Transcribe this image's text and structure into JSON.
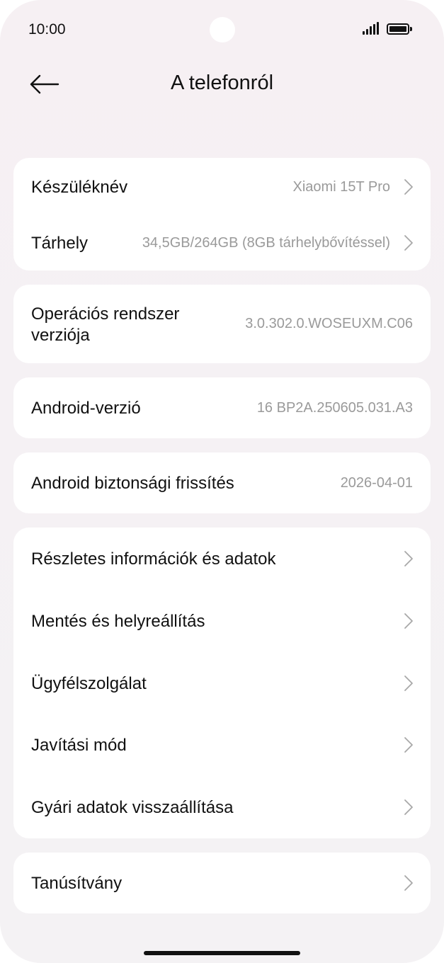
{
  "status_bar": {
    "time": "10:00",
    "signal_icon": "signal-bars-icon",
    "battery_icon": "battery-full-icon"
  },
  "header": {
    "title": "A telefonról",
    "back_icon": "arrow-left-icon"
  },
  "device_card": {
    "device_name": {
      "label": "Készüléknév",
      "value": "Xiaomi 15T Pro"
    },
    "storage": {
      "label": "Tárhely",
      "value": "34,5GB/264GB (8GB tárhelybővítéssel)"
    }
  },
  "os_card": {
    "label_line1": "Operációs rendszer",
    "label_line2": "verziója",
    "value": "3.0.302.0.WOSEUXM.C06"
  },
  "android_card": {
    "label": "Android-verzió",
    "value": "16 BP2A.250605.031.A3"
  },
  "security_card": {
    "label": "Android biztonsági frissítés",
    "value": "2026-04-01"
  },
  "menu_card": {
    "items": [
      {
        "label": "Részletes információk és adatok"
      },
      {
        "label": "Mentés és helyreállítás"
      },
      {
        "label": "Ügyfélszolgálat"
      },
      {
        "label": "Javítási mód"
      },
      {
        "label": "Gyári adatok visszaállítása"
      }
    ]
  },
  "cert_card": {
    "label": "Tanúsítvány"
  },
  "colors": {
    "background": "#f5f1f4",
    "card": "#ffffff",
    "text_primary": "#111111",
    "text_secondary": "#9a9a9a",
    "chevron": "#a8a8a8"
  }
}
